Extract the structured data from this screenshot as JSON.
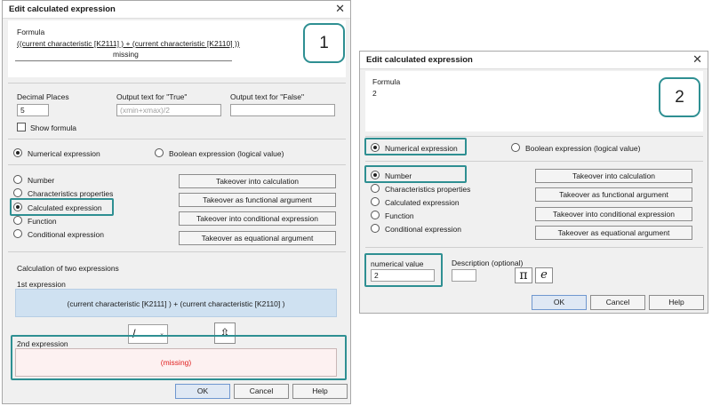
{
  "dialog1": {
    "title": "Edit calculated expression",
    "close_glyph": "✕",
    "badge": "1",
    "formula_label": "Formula",
    "formula_text": "((current characteristic [K2111] ) + (current characteristic [K2110] ))",
    "formula_missing": "missing",
    "decimal_places_label": "Decimal Places",
    "decimal_places_value": "5",
    "output_true_label": "Output text for \"True\"",
    "output_true_placeholder": "(xmin+xmax)/2",
    "output_false_label": "Output text for \"False\"",
    "output_false_value": "",
    "show_formula_label": "Show formula",
    "expr_type": {
      "numerical_label": "Numerical expression",
      "boolean_label": "Boolean expression (logical value)",
      "selected": "numerical"
    },
    "kinds": [
      {
        "label": "Number",
        "selected": false
      },
      {
        "label": "Characteristics properties",
        "selected": false
      },
      {
        "label": "Calculated expression",
        "selected": true
      },
      {
        "label": "Function",
        "selected": false
      },
      {
        "label": "Conditional expression",
        "selected": false
      }
    ],
    "takeover_buttons": [
      "Takeover into calculation",
      "Takeover as functional argument",
      "Takeover into conditional expression",
      "Takeover as equational argument"
    ],
    "calc_title": "Calculation of two expressions",
    "first_label": "1st expression",
    "first_value": "(current characteristic [K2111] ) + (current characteristic [K2110] )",
    "operator_value": "/",
    "combo_arrow": "⌄",
    "swap_icon": "⇳",
    "second_label": "2nd expression",
    "second_value": "(missing)",
    "ok_label": "OK",
    "cancel_label": "Cancel",
    "help_label": "Help"
  },
  "dialog2": {
    "title": "Edit calculated expression",
    "close_glyph": "✕",
    "badge": "2",
    "formula_label": "Formula",
    "formula_value": "2",
    "expr_type": {
      "numerical_label": "Numerical expression",
      "boolean_label": "Boolean expression (logical value)",
      "selected": "numerical"
    },
    "kinds": [
      {
        "label": "Number",
        "selected": true
      },
      {
        "label": "Characteristics properties",
        "selected": false
      },
      {
        "label": "Calculated expression",
        "selected": false
      },
      {
        "label": "Function",
        "selected": false
      },
      {
        "label": "Conditional expression",
        "selected": false
      }
    ],
    "takeover_buttons": [
      "Takeover into calculation",
      "Takeover as functional argument",
      "Takeover into conditional expression",
      "Takeover as equational argument"
    ],
    "numerical_value_label": "numerical value",
    "numerical_value": "2",
    "description_label": "Description (optional)",
    "description_value": "",
    "pi_glyph": "π",
    "e_glyph": "e",
    "ok_label": "OK",
    "cancel_label": "Cancel",
    "help_label": "Help"
  },
  "colors": {
    "highlight": "#2e8f92",
    "expr1_fill": "#cfe1f1",
    "missing_text": "#e02020"
  }
}
